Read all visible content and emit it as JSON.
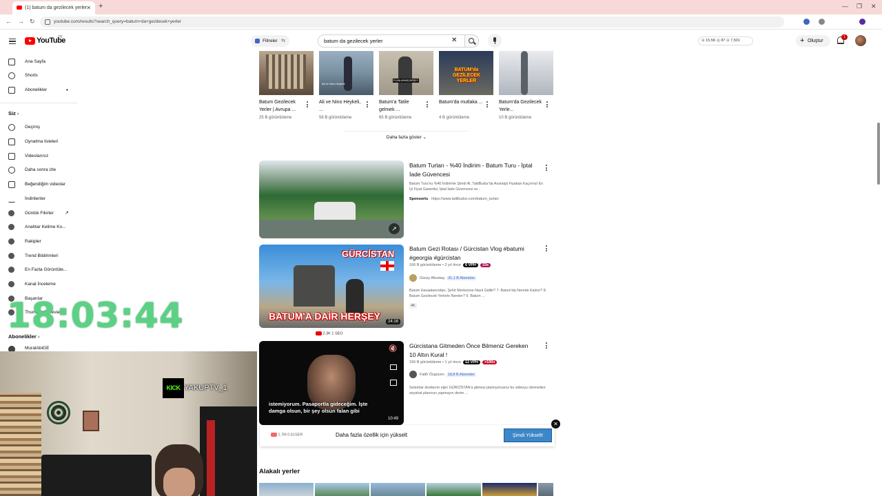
{
  "browser": {
    "tab_title": "(1) batum da gezilecek yerler -",
    "url": "youtube.com/results?search_query=batum+da+gezilecek+yerler"
  },
  "header": {
    "logo_text": "YouTube",
    "country": "TR",
    "filters_label": "Filtreler",
    "search_value": "batum da gezilecek yerler",
    "stats": "⊙ 15.5K  ◎ 87  ⊙ 7,501",
    "create_label": "Oluştur",
    "notification_count": "1"
  },
  "sidebar": {
    "items": [
      {
        "label": "Ana Sayfa",
        "icon": "home-icon"
      },
      {
        "label": "Shorts",
        "icon": "shorts-icon"
      },
      {
        "label": "Abonelikler",
        "icon": "subscriptions-icon"
      }
    ],
    "you_heading": "Siz",
    "you_items": [
      {
        "label": "Geçmiş",
        "icon": "history-icon"
      },
      {
        "label": "Oynatma listeleri",
        "icon": "playlists-icon"
      },
      {
        "label": "Videolarınız",
        "icon": "your-videos-icon"
      },
      {
        "label": "Daha sonra izle",
        "icon": "watch-later-icon"
      },
      {
        "label": "Beğendiğim videolar",
        "icon": "liked-icon"
      },
      {
        "label": "İndirilenler",
        "icon": "download-icon"
      },
      {
        "label": "Günlük Fikirler",
        "icon": "extension-icon"
      },
      {
        "label": "Anahtar Kelime Ko...",
        "icon": "extension-icon"
      },
      {
        "label": "Rakipler",
        "icon": "extension-icon"
      },
      {
        "label": "Trend Bildirimleri",
        "icon": "extension-icon"
      },
      {
        "label": "En Fazla Görüntüle...",
        "icon": "extension-icon"
      },
      {
        "label": "Kanal İnceleme",
        "icon": "extension-icon"
      },
      {
        "label": "Başarılar",
        "icon": "extension-icon"
      },
      {
        "label": "Thumbnail Preview",
        "icon": "extension-icon"
      }
    ],
    "subs_heading": "Abonelikler",
    "sub_first": "MuratAbiGE"
  },
  "overlay": {
    "clock": "18:03:44",
    "kick_logo": "KICK",
    "kick_name": "YAKUPTV_1"
  },
  "shorts": [
    {
      "title": "Batum Gezilecek Yerler | Avrupa ...",
      "views": "25 B görüntüleme"
    },
    {
      "title": "Ali ve Nino Heykeli, ...",
      "views": "58 B görüntüleme"
    },
    {
      "title": "Batum'a Tatile gelmek ...",
      "views": "65 B görüntüleme"
    },
    {
      "title": "Batum'da mutlaka ...",
      "views": "4 B görüntüleme"
    },
    {
      "title": "Batum'da Gezilecek Yerle...",
      "views": "10 B görüntüleme"
    }
  ],
  "shorts_thumb_text": {
    "s2": "Ali ve Nino Heykeli",
    "s3": "PLANLANMIŞ BİRŞEY",
    "s4": "BATUM'da GEZİLECEK YERLER"
  },
  "show_more": "Daha fazla göster",
  "videos": [
    {
      "title": "Batum Turları - %40 İndirim - Batum Turu - İptal İade Güvencesi",
      "desc": "Batum Turu'nu %40 İndirimle Şimdi Al, TatilBudur'da Avantajlı Fiyattan Kaçırma! En İyi Fiyat Garantisi, İptal İade Güvencesi ve...",
      "sponsor_label": "Sponsorlu",
      "sponsor_url": "https://www.tatilbudur.com/batum_turlari"
    },
    {
      "title": "Batum Gezi Rotası / Gürcistan Vlog #batumi #georgia #gürcistan",
      "meta": "166 B görüntüleme • 2 yıl önce",
      "vph": "6 VPH",
      "score": "33x",
      "channel": "Güray Altuntaş",
      "subs": "31,1 B Aboneler",
      "desc": "Batum Havaalanından, Şehir Merkezine Nasıl Gidilir? 7. Batum'da Nerede Kalınır? 8. Batum Gezilecek Yerlerle Nereler? 9. Batum ...",
      "badge": "4K",
      "duration": "24:16",
      "thumb_top": "GÜRCİSTAN",
      "thumb_bottom": "BATUM'A DAİR HERŞEY",
      "below_stats": "2.3K  1 SEO"
    },
    {
      "title": "Gürcistana Gitmeden Önce Bilmeniz Gereken 10 Altın Kural !",
      "meta": "156 B görüntüleme • 1 yıl önce",
      "vph": "12 VPH",
      "score": ">100x",
      "channel": "Fatih Özgüven",
      "subs": "18,8 B Aboneler",
      "desc": "Selamlar dostlarım eğer GÜRCİSTAN'a gitmeyi planlıyorsanız bu videoyu izlemeden seyahat planınızı yapmayın derim ...",
      "duration": "10:49",
      "caption": "istemiyorum. Pasaportla gideceğim. İşte damga olsun, bir şey olsun falan gibi"
    }
  ],
  "popup": {
    "stats": "1.7M  0.61SER",
    "text": "Daha fazla özellik için yükselt",
    "button": "Şimdi Yükselt!"
  },
  "related_heading": "Alakalı yerler"
}
